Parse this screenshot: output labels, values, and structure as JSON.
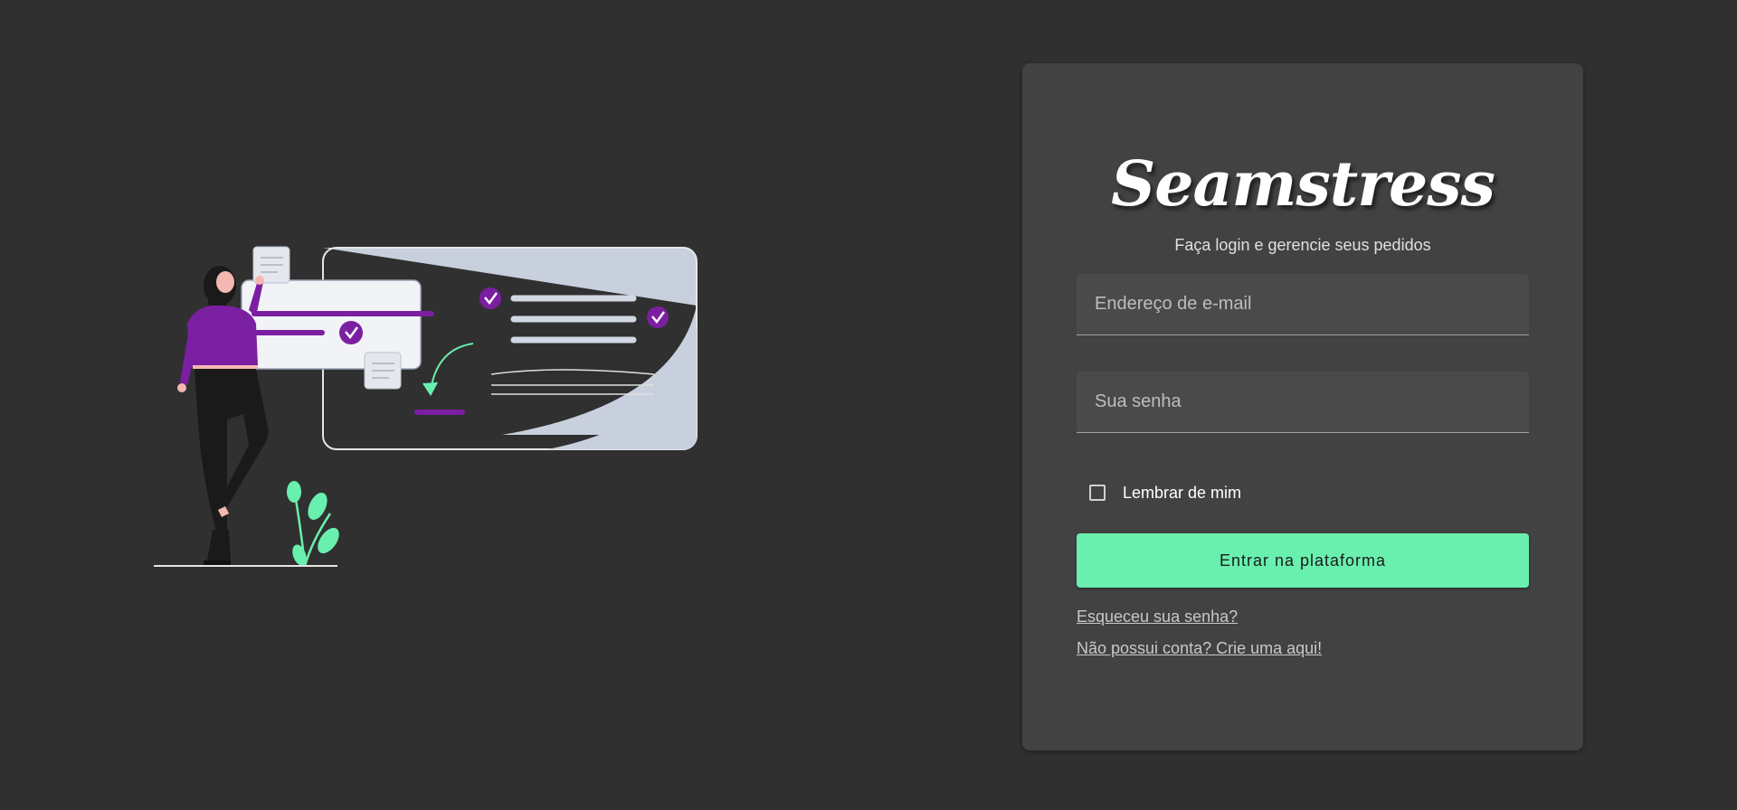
{
  "brand": {
    "name": "Seamstress",
    "subtitle": "Faça login e gerencie seus pedidos"
  },
  "form": {
    "email_placeholder": "Endereço de e-mail",
    "password_placeholder": "Sua senha",
    "remember_label": "Lembrar de mim",
    "remember_checked": false,
    "submit_label": "Entrar na plataforma"
  },
  "links": {
    "forgot_password": "Esqueceu sua senha?",
    "signup": "Não possui conta? Crie uma aqui!"
  },
  "colors": {
    "background": "#303030",
    "card": "#424242",
    "accent": "#69f0ae",
    "illustration_purple": "#7b1fa2",
    "illustration_green": "#69f0ae"
  }
}
